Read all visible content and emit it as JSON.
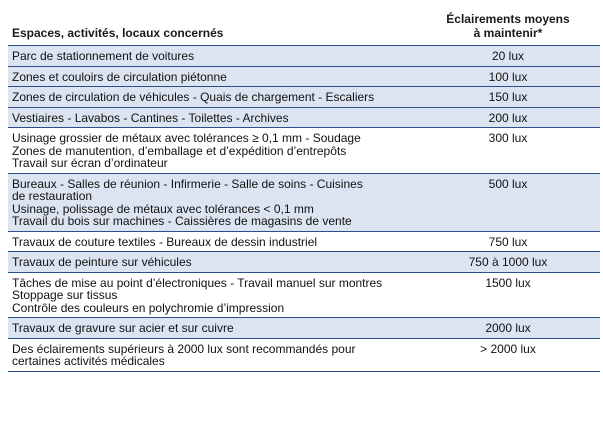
{
  "header": {
    "col1": "Espaces, activités, locaux concernés",
    "col2_line1": "Éclairements moyens",
    "col2_line2": "à maintenir*"
  },
  "rows": [
    {
      "lines": [
        "Parc de stationnement de voitures"
      ],
      "value": "20 lux"
    },
    {
      "lines": [
        "Zones et couloirs de circulation piétonne"
      ],
      "value": "100 lux"
    },
    {
      "lines": [
        "Zones de circulation de véhicules - Quais de chargement - Escaliers"
      ],
      "value": "150 lux"
    },
    {
      "lines": [
        "Vestiaires - Lavabos - Cantines - Toilettes - Archives"
      ],
      "value": "200 lux"
    },
    {
      "lines": [
        "Usinage grossier de métaux avec tolérances ≥ 0,1 mm - Soudage",
        "Zones de manutention, d’emballage et d’expédition d’entrepôts",
        "Travail sur écran d’ordinateur"
      ],
      "value": "300 lux"
    },
    {
      "lines": [
        "Bureaux - Salles de réunion - Infirmerie - Salle de soins - Cuisines",
        "de restauration",
        "Usinage, polissage de métaux avec tolérances < 0,1 mm",
        "Travail du bois sur machines - Caissières de magasins de vente"
      ],
      "value": "500 lux"
    },
    {
      "lines": [
        "Travaux de couture textiles - Bureaux de dessin industriel"
      ],
      "value": "750 lux"
    },
    {
      "lines": [
        "Travaux de peinture sur véhicules"
      ],
      "value": "750 à 1000 lux"
    },
    {
      "lines": [
        "Tâches de mise au point d’électroniques - Travail manuel sur montres",
        "Stoppage sur tissus",
        "Contrôle des couleurs en polychromie d’impression"
      ],
      "value": "1500 lux"
    },
    {
      "lines": [
        "Travaux de gravure sur acier et sur cuivre"
      ],
      "value": "2000 lux"
    },
    {
      "lines": [
        "Des éclairements supérieurs à 2000 lux sont recommandés pour",
        "certaines activités médicales"
      ],
      "value": "> 2000 lux"
    }
  ],
  "colors": {
    "row_shade": "#dde4f1",
    "rule": "#2b4f8c"
  }
}
